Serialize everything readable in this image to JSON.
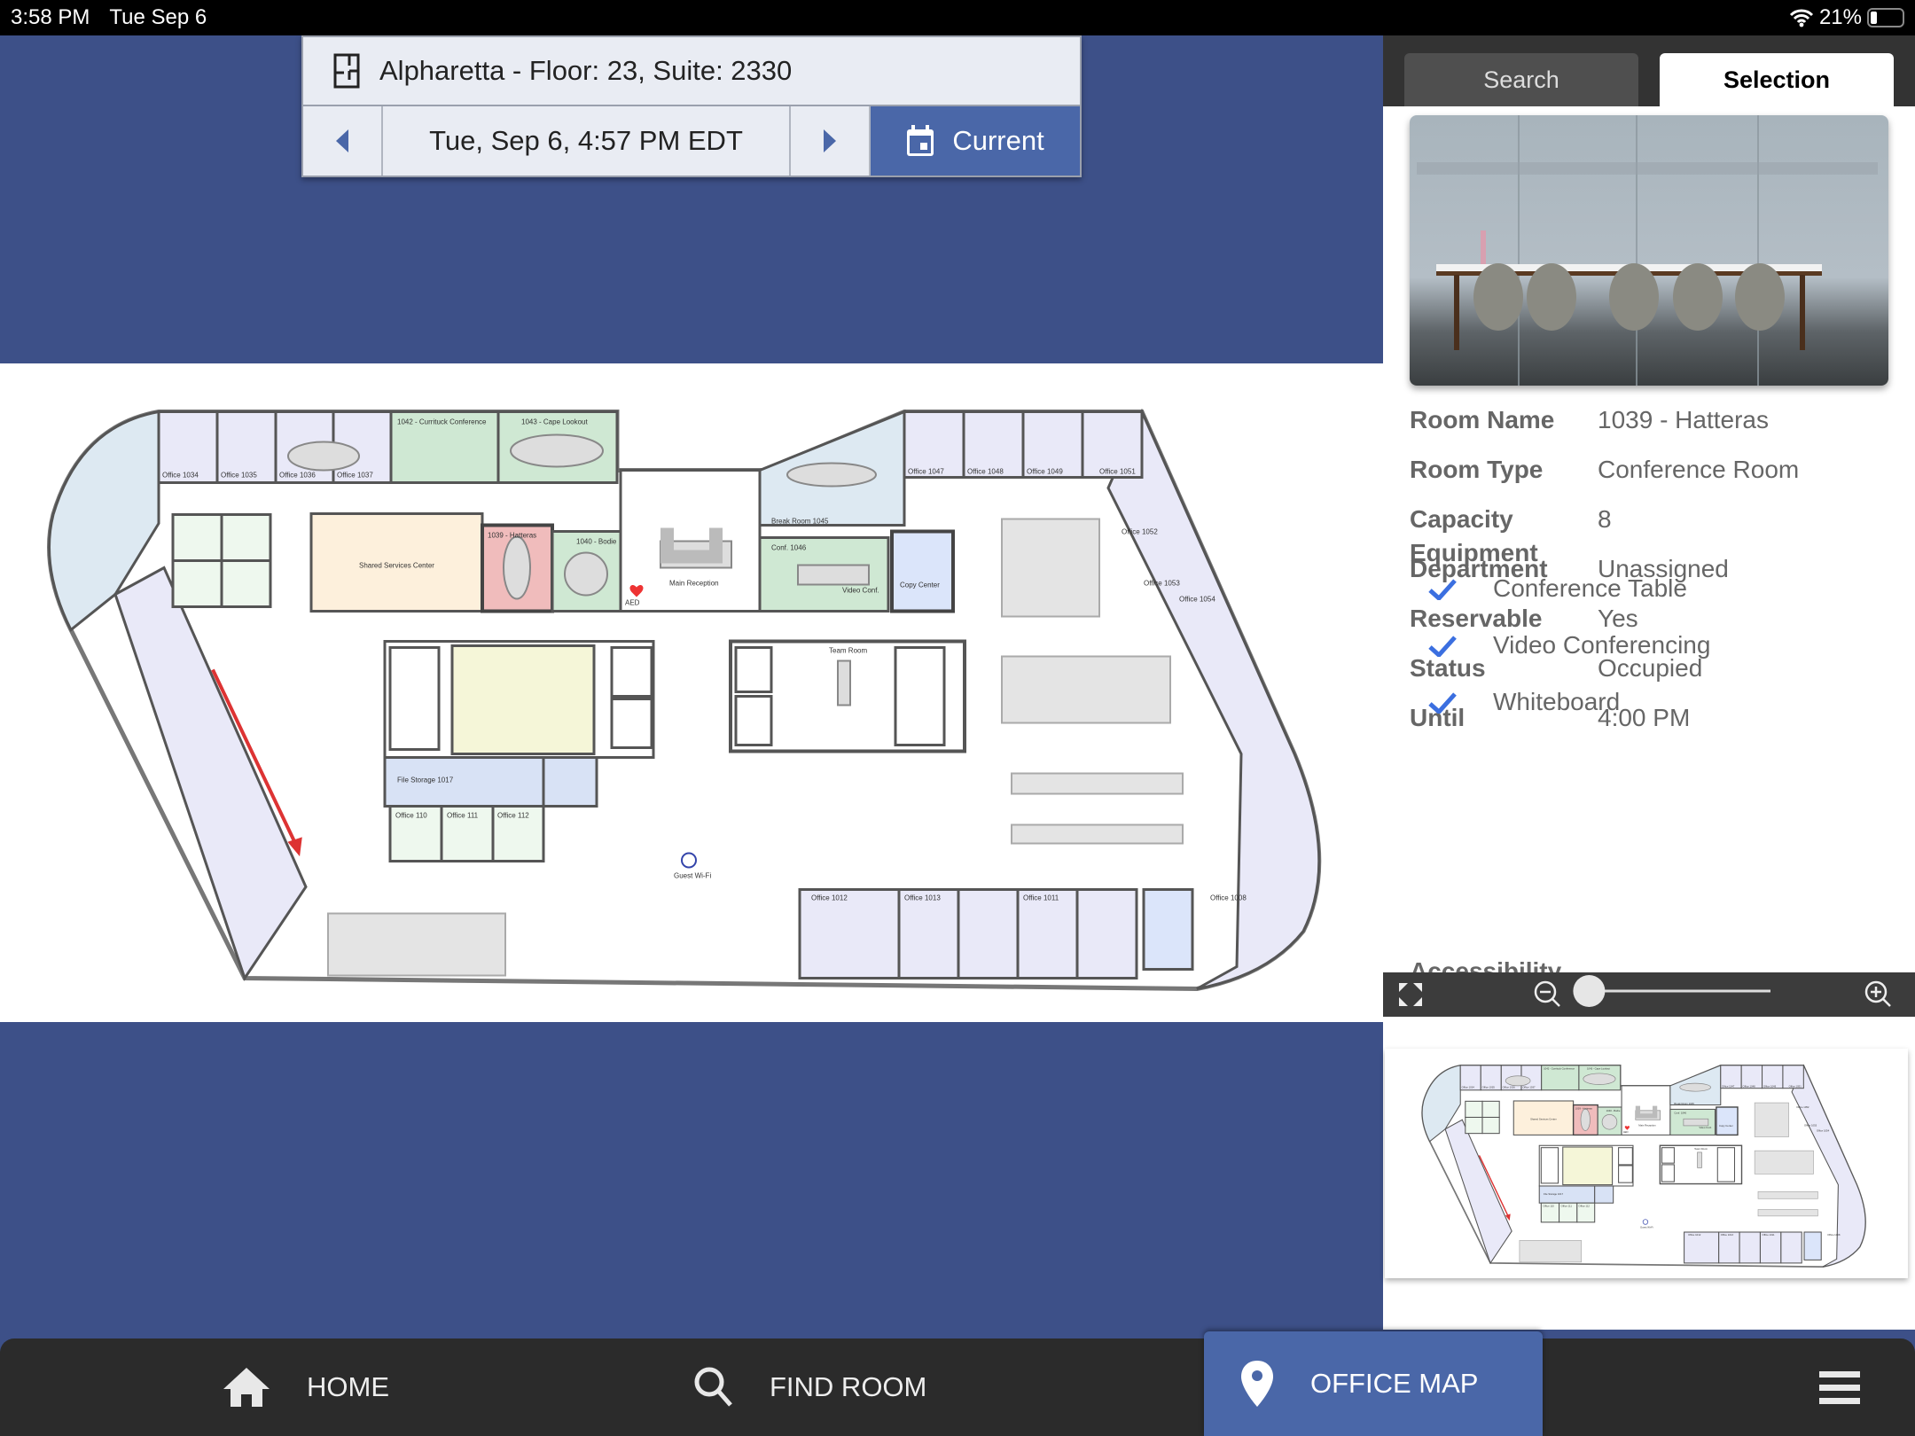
{
  "status_bar": {
    "time": "3:58 PM",
    "date": "Tue Sep 6",
    "battery": "21%",
    "battery_level": 0.21
  },
  "header": {
    "location": "Alpharetta - Floor: 23, Suite: 2330",
    "datetime": "Tue, Sep 6, 4:57 PM  EDT",
    "current_label": "Current"
  },
  "panel": {
    "tabs": [
      {
        "label": "Search",
        "active": false
      },
      {
        "label": "Selection",
        "active": true
      }
    ],
    "details": [
      {
        "label": "Room Name",
        "value": "1039 - Hatteras"
      },
      {
        "label": "Room Type",
        "value": "Conference Room"
      },
      {
        "label": "Capacity",
        "value": "8"
      },
      {
        "label": "Department",
        "value": "Unassigned"
      },
      {
        "label": "Reservable",
        "value": "Yes"
      },
      {
        "label": "Status",
        "value": "Occupied"
      },
      {
        "label": "Until",
        "value": "4:00 PM"
      }
    ],
    "equipment_label": "Equipment",
    "equipment": [
      "Conference Table",
      "Video Conferencing",
      "Whiteboard"
    ],
    "accessibility_label": "Accessibility"
  },
  "zoom": {
    "level": 0.07
  },
  "floor_plan": {
    "rooms": [
      "1042 - Currituck Conference",
      "1043 - Cape Lookout",
      "Office 1036",
      "Office 1037",
      "Shared Services Center",
      "1039 - Hatteras",
      "1040 - Bodie",
      "Main Reception",
      "Break Room 1045",
      "Conf. 1046",
      "Copy Center",
      "Office 1047",
      "Office 1048",
      "Office 1049",
      "Office 1051",
      "Office 1052",
      "Office 1053",
      "Office 1054",
      "File Storage 1017",
      "Office 110",
      "Office 111",
      "Office 112",
      "Team Room",
      "Office 1012",
      "Office 1013",
      "Office 1011",
      "Office 1008",
      "Guest Wi-Fi",
      "AED",
      "Video Conf.",
      "Office 1034",
      "Office 1035"
    ],
    "colors": {
      "conference_available": "#cfe8d3",
      "selected_occupied": "#f0bcbc",
      "office": "#e9e9f8",
      "shared": "#fdf0dc",
      "break": "#dde9f2",
      "copy": "#dbe5fa",
      "restroom": "#f5f6d8"
    }
  },
  "bottom_nav": [
    {
      "label": "HOME",
      "icon": "home-icon"
    },
    {
      "label": "FIND ROOM",
      "icon": "search-icon"
    },
    {
      "label": "OFFICE MAP",
      "icon": "map-pin-icon",
      "active": true
    },
    {
      "label": "",
      "icon": "menu-icon"
    }
  ],
  "colors": {
    "background": "#3d5088",
    "accent": "#4a67a8",
    "check": "#3b6fe0"
  }
}
